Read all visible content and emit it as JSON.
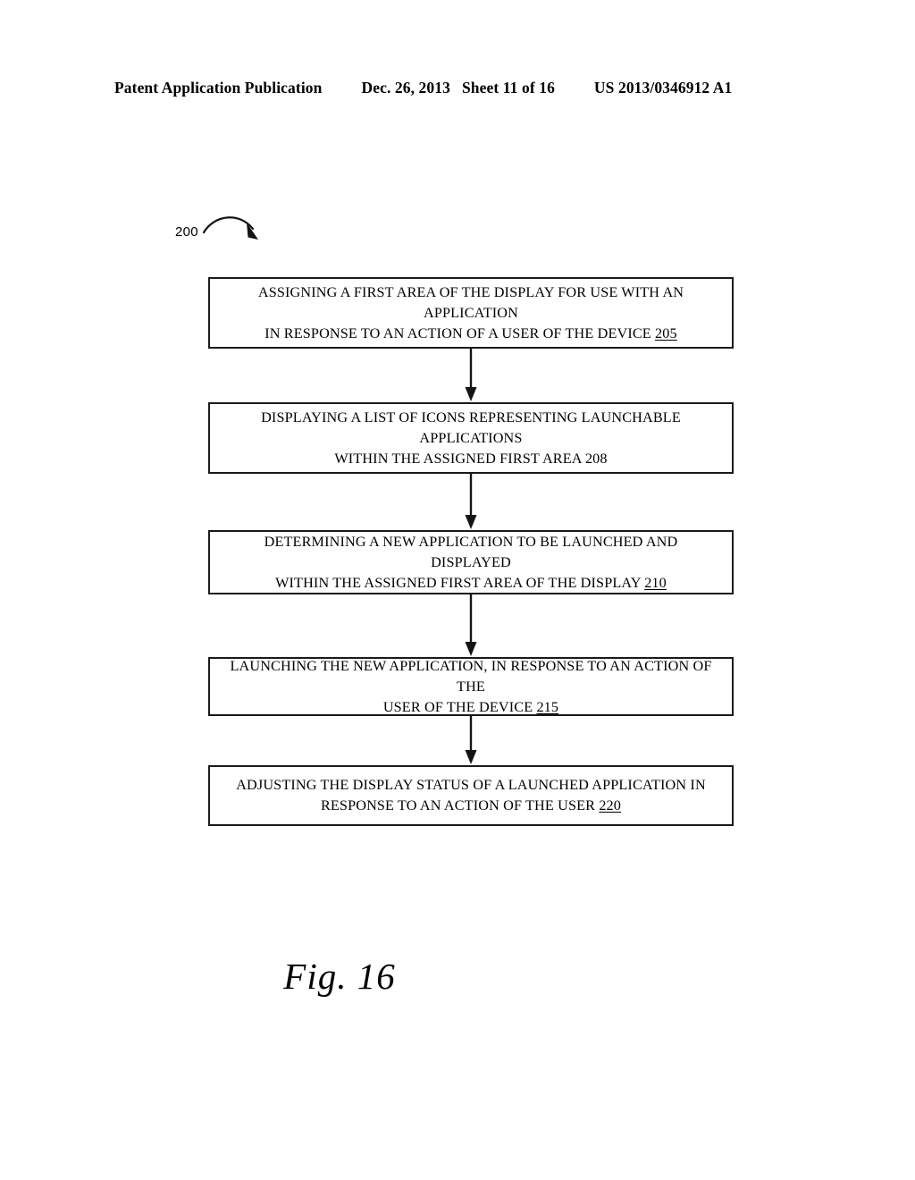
{
  "header": {
    "publication": "Patent Application Publication",
    "date": "Dec. 26, 2013",
    "sheet": "Sheet 11 of 16",
    "patent_number": "US 2013/0346912 A1"
  },
  "figure": {
    "reference_numeral": "200",
    "caption": "Fig. 16"
  },
  "flowchart": {
    "type": "vertical-flowchart",
    "steps": [
      {
        "id": "205",
        "text": "ASSIGNING A FIRST AREA OF THE DISPLAY FOR USE WITH AN APPLICATION\nIN RESPONSE TO AN ACTION OF A USER OF THE DEVICE ",
        "numeral": "205",
        "numeral_underlined": true
      },
      {
        "id": "208",
        "text": "DISPLAYING A LIST OF ICONS REPRESENTING LAUNCHABLE APPLICATIONS\nWITHIN THE ASSIGNED FIRST AREA ",
        "numeral": "208",
        "numeral_underlined": false
      },
      {
        "id": "210",
        "text": "DETERMINING A NEW APPLICATION TO BE LAUNCHED AND DISPLAYED\nWITHIN THE ASSIGNED FIRST AREA OF THE DISPLAY ",
        "numeral": "210",
        "numeral_underlined": true
      },
      {
        "id": "215",
        "text": "LAUNCHING THE NEW APPLICATION, IN RESPONSE TO AN ACTION OF THE\nUSER OF THE DEVICE ",
        "numeral": "215",
        "numeral_underlined": true
      },
      {
        "id": "220",
        "text": "ADJUSTING THE DISPLAY STATUS OF  A LAUNCHED APPLICATION IN\nRESPONSE TO AN ACTION OF THE USER ",
        "numeral": "220",
        "numeral_underlined": true
      }
    ]
  },
  "colors": {
    "ink": "#1a1a1a",
    "paper": "#ffffff"
  }
}
